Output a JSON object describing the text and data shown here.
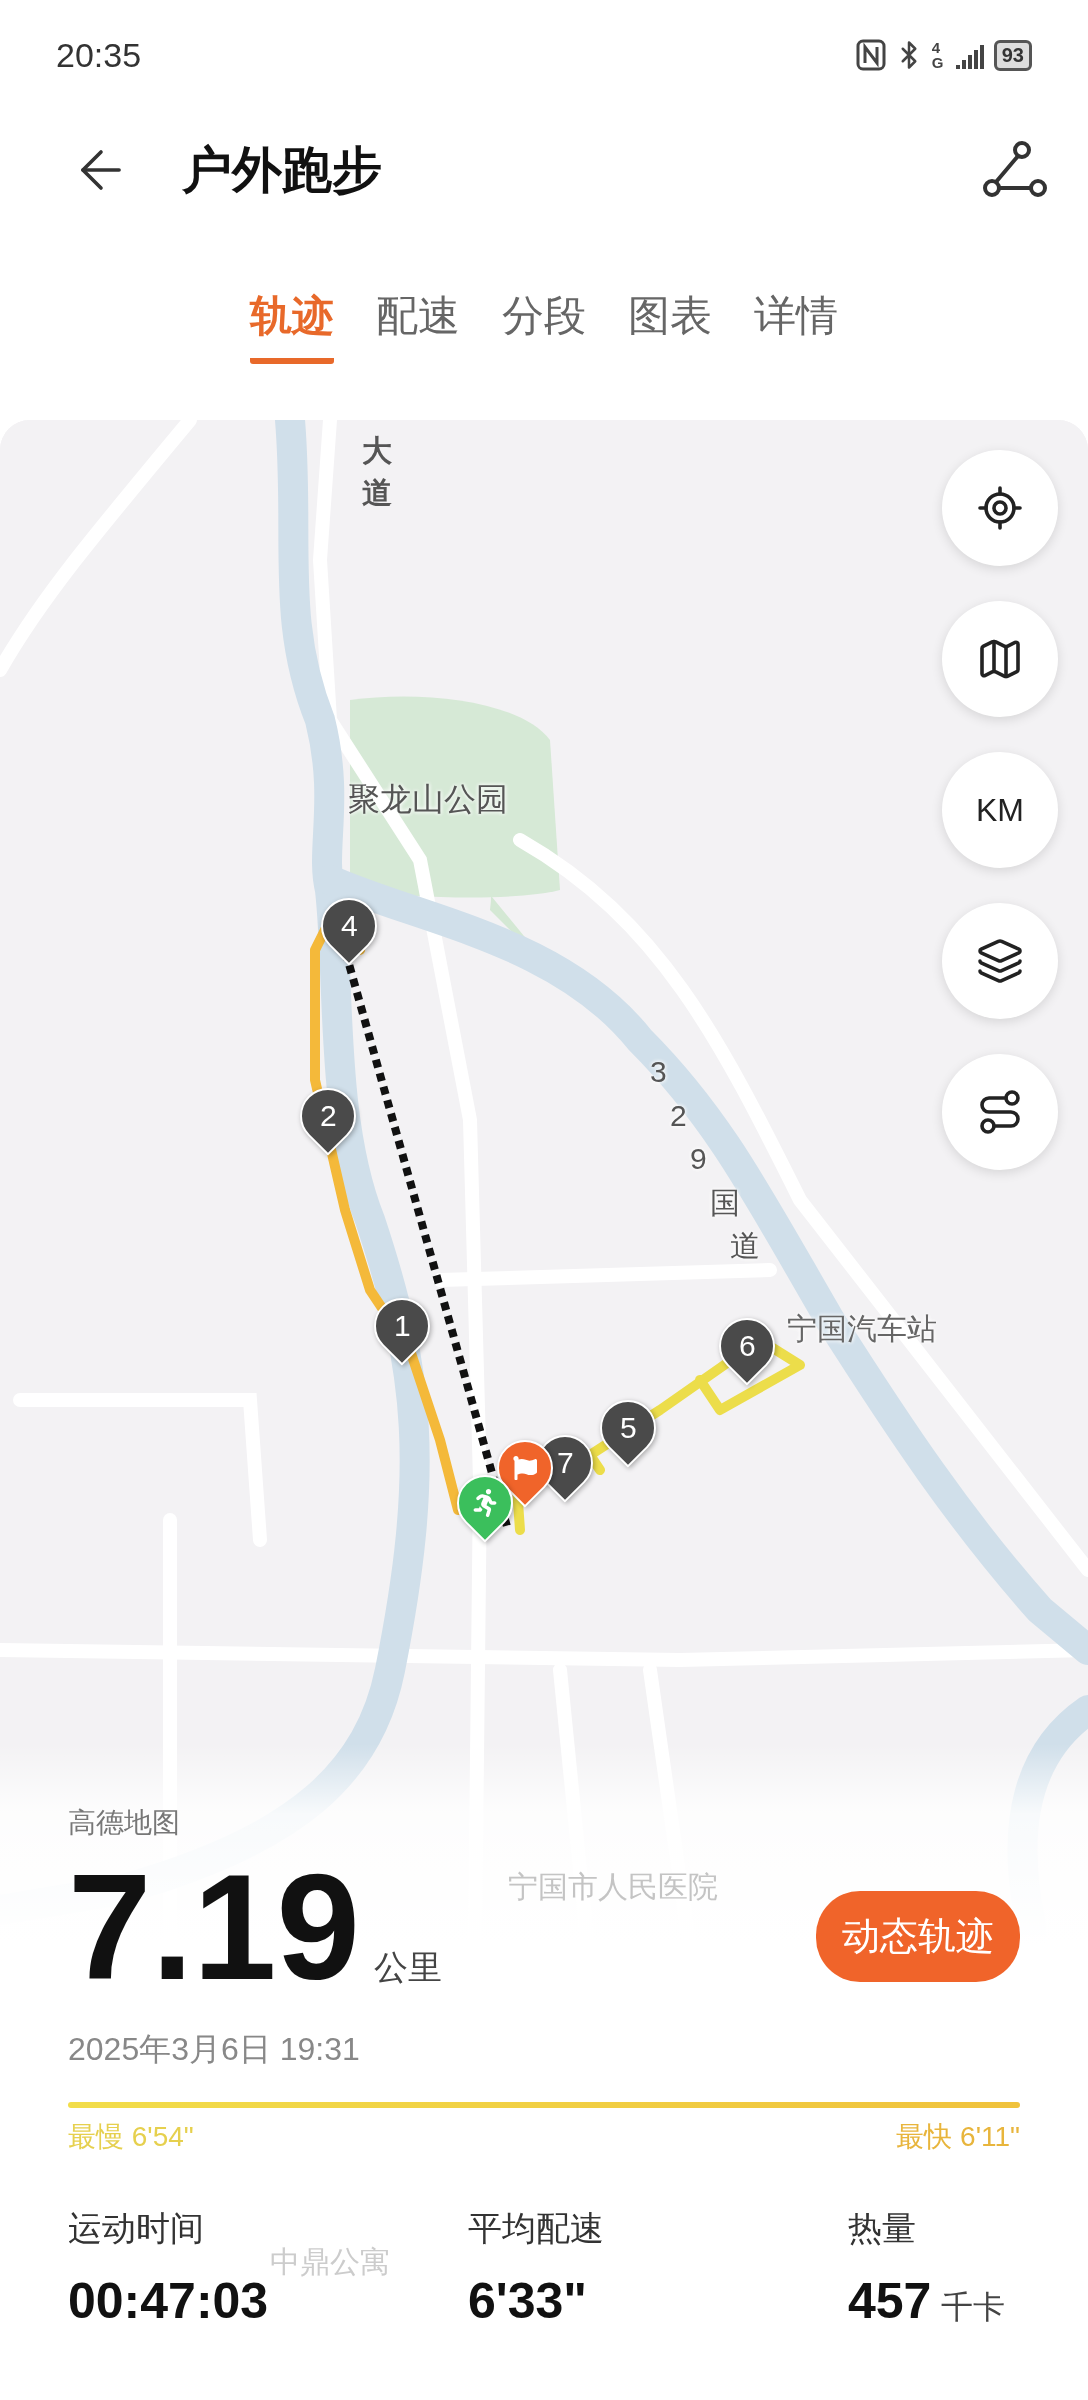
{
  "status_bar": {
    "time": "20:35",
    "network": "4G",
    "battery": "93"
  },
  "header": {
    "title": "户外跑步"
  },
  "tabs": [
    {
      "label": "轨迹",
      "selected": true
    },
    {
      "label": "配速",
      "selected": false
    },
    {
      "label": "分段",
      "selected": false
    },
    {
      "label": "图表",
      "selected": false
    },
    {
      "label": "详情",
      "selected": false
    }
  ],
  "map": {
    "labels": [
      {
        "kind": "vertical",
        "text": "大道"
      },
      {
        "kind": "park",
        "text": "聚龙山公园"
      },
      {
        "kind": "diagonal",
        "text": "329国道"
      },
      {
        "kind": "place",
        "text": "宁国汽车站"
      },
      {
        "kind": "faded",
        "text": "宁国市人民医院"
      },
      {
        "kind": "faded",
        "text": "中鼎公寓"
      }
    ],
    "provider": "高德地图",
    "markers": [
      {
        "kind": "split",
        "label": "4"
      },
      {
        "kind": "split",
        "label": "2"
      },
      {
        "kind": "split",
        "label": "1"
      },
      {
        "kind": "split",
        "label": "6"
      },
      {
        "kind": "split",
        "label": "5"
      },
      {
        "kind": "split",
        "label": "7"
      },
      {
        "kind": "finish"
      },
      {
        "kind": "start"
      }
    ],
    "controls": [
      {
        "kind": "locate"
      },
      {
        "kind": "map"
      },
      {
        "kind": "unit",
        "label": "KM"
      },
      {
        "kind": "layers"
      },
      {
        "kind": "route"
      }
    ]
  },
  "summary": {
    "distance": "7.19",
    "unit": "公里",
    "date": "2025年3月6日 19:31",
    "action": "动态轨迹",
    "slowest": "最慢 6'54\"",
    "fastest": "最快 6'11\"",
    "stats": [
      {
        "label": "运动时间",
        "value": "00:47:03"
      },
      {
        "label": "平均配速",
        "value": "6'33\""
      },
      {
        "label": "热量",
        "value": "457",
        "unit": "千卡"
      }
    ]
  }
}
